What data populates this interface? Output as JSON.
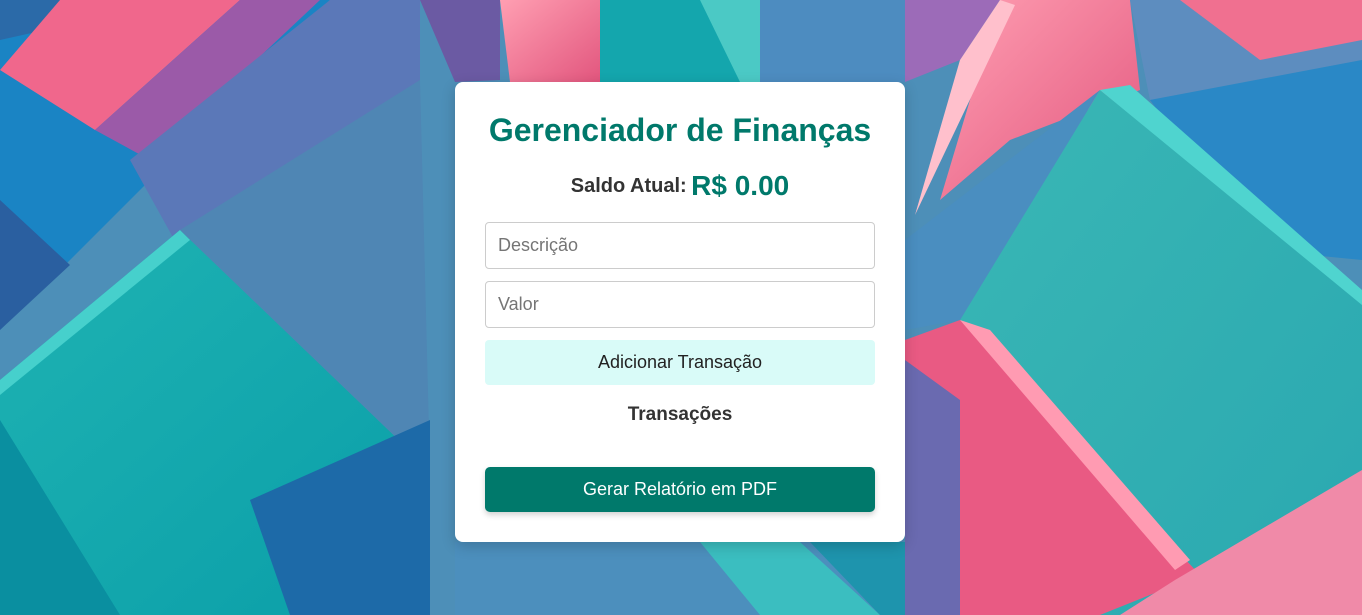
{
  "app": {
    "title": "Gerenciador de Finanças"
  },
  "balance": {
    "label": "Saldo Atual:",
    "value": "R$ 0.00"
  },
  "form": {
    "description_placeholder": "Descrição",
    "description_value": "",
    "amount_placeholder": "Valor",
    "amount_value": "",
    "add_button_label": "Adicionar Transação"
  },
  "transactions": {
    "heading": "Transações",
    "items": []
  },
  "report": {
    "button_label": "Gerar Relatório em PDF"
  },
  "colors": {
    "accent": "#00796b",
    "add_button_bg": "#d9fbf8",
    "card_bg": "#ffffff",
    "text_dark": "#333333"
  }
}
